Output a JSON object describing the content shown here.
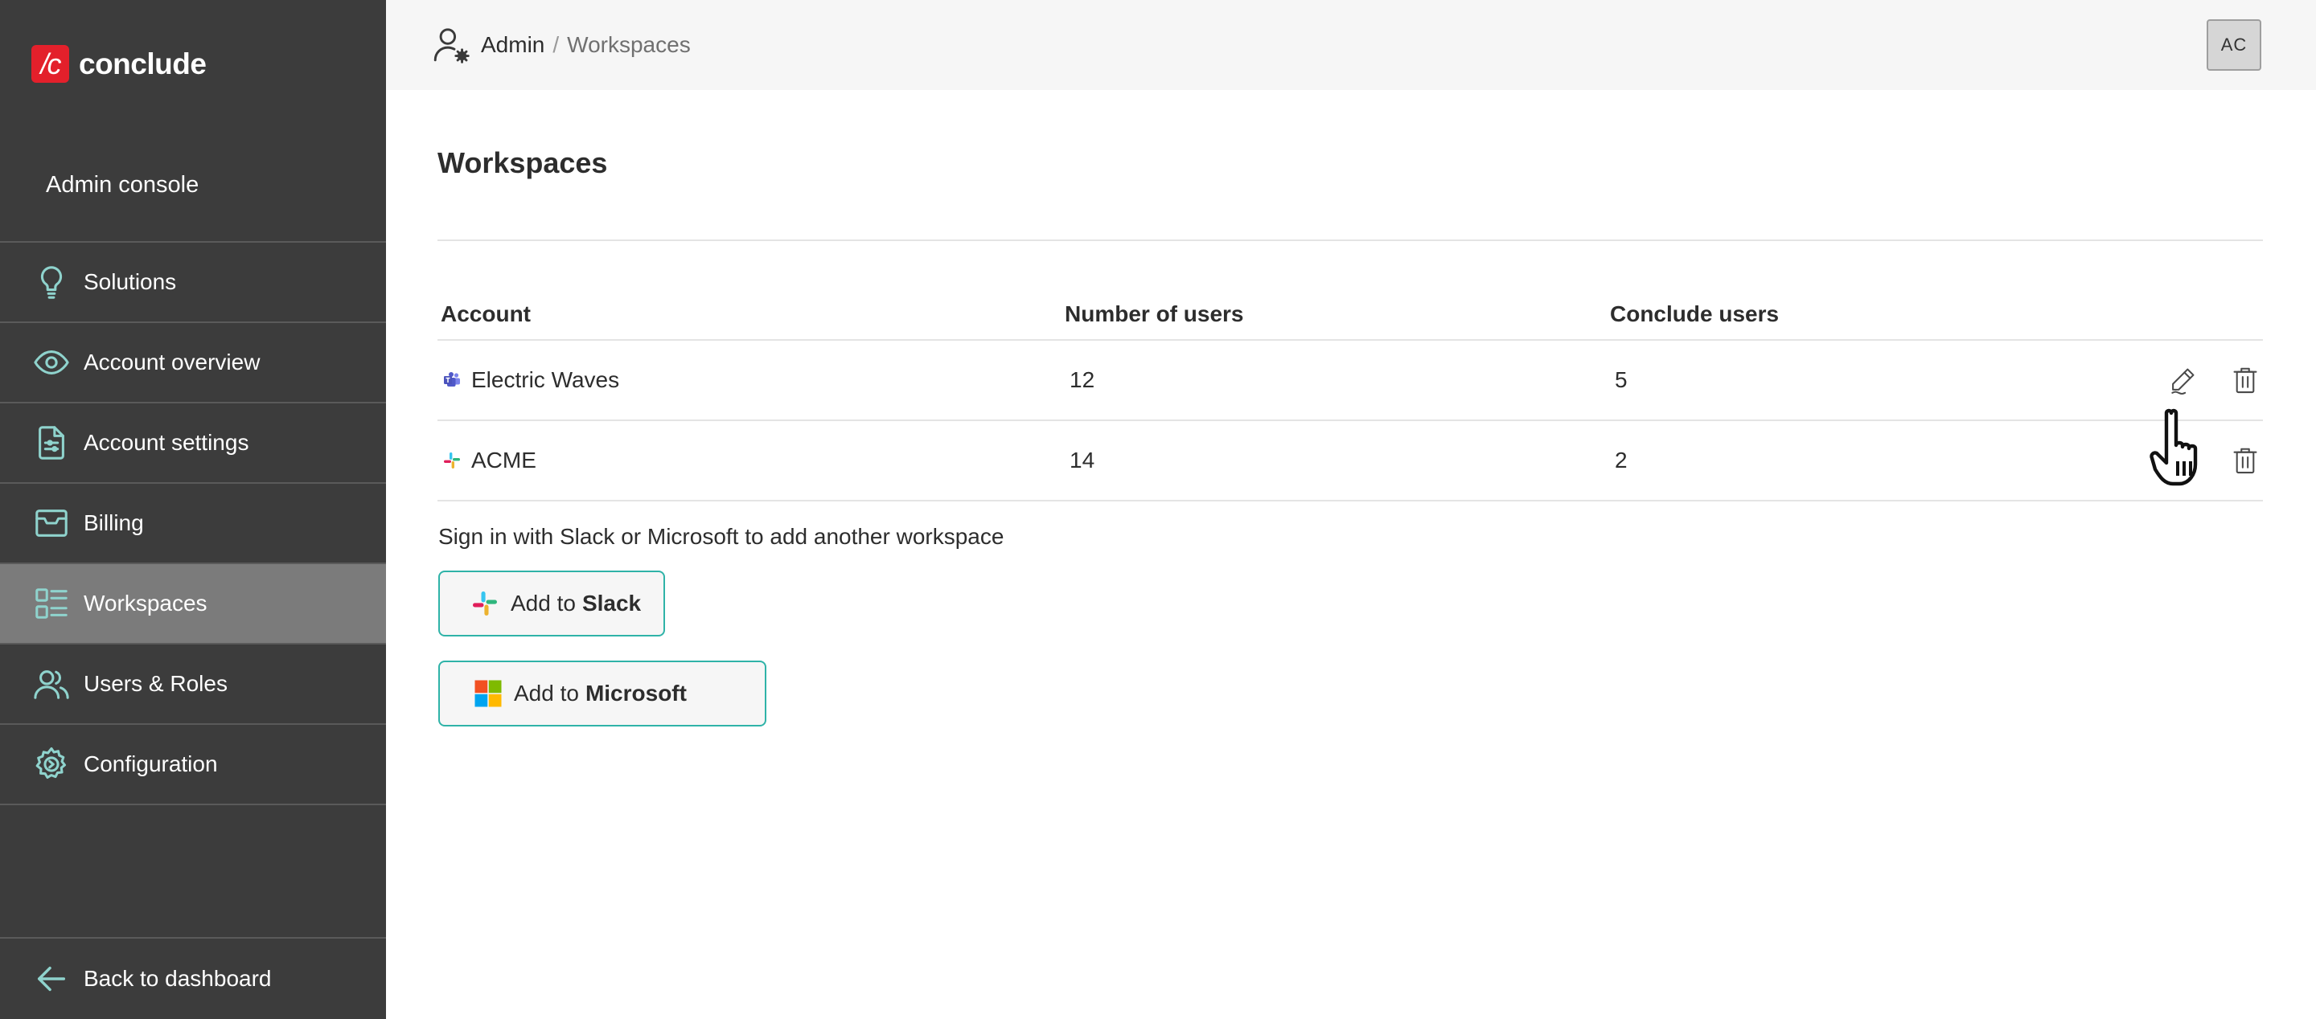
{
  "brand": {
    "logo_mark": "/c",
    "name": "conclude",
    "accent": "#e3202b"
  },
  "sidebar": {
    "title": "Admin console",
    "items": [
      {
        "label": "Solutions",
        "icon": "lightbulb-icon",
        "active": false
      },
      {
        "label": "Account overview",
        "icon": "eye-icon",
        "active": false
      },
      {
        "label": "Account settings",
        "icon": "document-settings-icon",
        "active": false
      },
      {
        "label": "Billing",
        "icon": "envelope-icon",
        "active": false
      },
      {
        "label": "Workspaces",
        "icon": "list-grid-icon",
        "active": true
      },
      {
        "label": "Users & Roles",
        "icon": "users-icon",
        "active": false
      },
      {
        "label": "Configuration",
        "icon": "gear-icon",
        "active": false
      }
    ],
    "back_label": "Back to dashboard"
  },
  "header": {
    "breadcrumb": [
      "Admin",
      "Workspaces"
    ],
    "separator": "/",
    "avatar_initials": "AC"
  },
  "main": {
    "title": "Workspaces",
    "table": {
      "columns": [
        "Account",
        "Number of users",
        "Conclude users"
      ],
      "rows": [
        {
          "account": "Electric Waves",
          "platform_icon": "microsoft-teams-icon",
          "users": "12",
          "conclude_users": "5"
        },
        {
          "account": "ACME",
          "platform_icon": "slack-icon",
          "users": "14",
          "conclude_users": "2"
        }
      ]
    },
    "hint": "Sign in with Slack or Microsoft to add another workspace",
    "add_slack": {
      "prefix": "Add to",
      "brand": "Slack"
    },
    "add_microsoft": {
      "prefix": "Add to",
      "brand": "Microsoft"
    }
  },
  "colors": {
    "sidebar_bg": "#3c3c3c",
    "sidebar_active": "#7b7b7b",
    "icon_teal": "#8fd3cd",
    "button_border": "#2fb3a8"
  }
}
